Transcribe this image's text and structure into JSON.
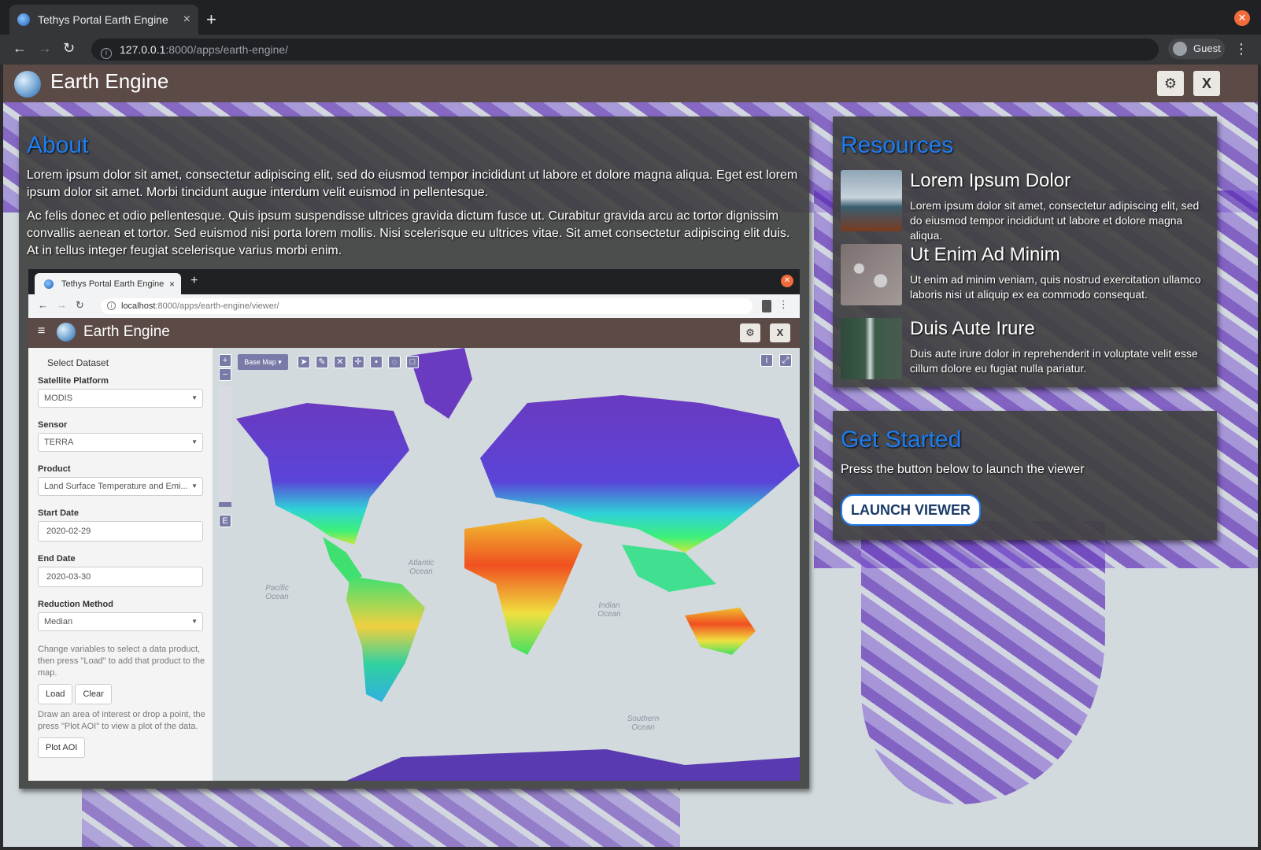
{
  "browser": {
    "tab_title": "Tethys Portal Earth Engine",
    "tab_close": "×",
    "new_tab": "+",
    "url_host": "127.0.0.1",
    "url_rest": ":8000/apps/earth-engine/",
    "profile": "Guest"
  },
  "app": {
    "title": "Earth Engine",
    "close_label": "X"
  },
  "about": {
    "heading": "About",
    "p1": "Lorem ipsum dolor sit amet, consectetur adipiscing elit, sed do eiusmod tempor incididunt ut labore et dolore magna aliqua. Eget est lorem ipsum dolor sit amet. Morbi tincidunt augue interdum velit euismod in pellentesque.",
    "p2": "Ac felis donec et odio pellentesque. Quis ipsum suspendisse ultrices gravida dictum fusce ut. Curabitur gravida arcu ac tortor dignissim convallis aenean et tortor. Sed euismod nisi porta lorem mollis. Nisi scelerisque eu ultrices vitae. Sit amet consectetur adipiscing elit duis. At in tellus integer feugiat scelerisque varius morbi enim."
  },
  "resources": {
    "heading": "Resources",
    "items": [
      {
        "title": "Lorem Ipsum Dolor",
        "desc": "Lorem ipsum dolor sit amet, consectetur adipiscing elit, sed do eiusmod tempor incididunt ut labore et dolore magna aliqua."
      },
      {
        "title": "Ut Enim Ad Minim",
        "desc": "Ut enim ad minim veniam, quis nostrud exercitation ullamco laboris nisi ut aliquip ex ea commodo consequat."
      },
      {
        "title": "Duis Aute Irure",
        "desc": "Duis aute irure dolor in reprehenderit in voluptate velit esse cillum dolore eu fugiat nulla pariatur."
      }
    ]
  },
  "get_started": {
    "heading": "Get Started",
    "text": "Press the button below to launch the viewer",
    "button": "LAUNCH VIEWER"
  },
  "inner": {
    "tab_title": "Tethys Portal Earth Engine",
    "url_host": "localhost",
    "url_rest": ":8000/apps/earth-engine/viewer/",
    "app_title": "Earth Engine",
    "close_label": "X",
    "sidebar": {
      "heading": "Select Dataset",
      "platform_label": "Satellite Platform",
      "platform_value": "MODIS",
      "sensor_label": "Sensor",
      "sensor_value": "TERRA",
      "product_label": "Product",
      "product_value": "Land Surface Temperature and Emi...",
      "start_label": "Start Date",
      "start_value": "2020-02-29",
      "end_label": "End Date",
      "end_value": "2020-03-30",
      "reduction_label": "Reduction Method",
      "reduction_value": "Median",
      "help1": "Change variables to select a data product, then press \"Load\" to add that product to the map.",
      "load": "Load",
      "clear": "Clear",
      "help2": "Draw an area of interest or drop a point, the press \"Plot AOI\" to view a plot of the data.",
      "plot": "Plot AOI"
    },
    "map": {
      "basemap": "Base Map ▾",
      "zoom_in": "+",
      "zoom_out": "−",
      "layer_e": "E",
      "info": "i",
      "labels": {
        "atlantic": "Atlantic\nOcean",
        "pacific": "Pacific\nOcean",
        "indian": "Indian\nOcean",
        "southern": "Southern\nOcean"
      }
    }
  }
}
